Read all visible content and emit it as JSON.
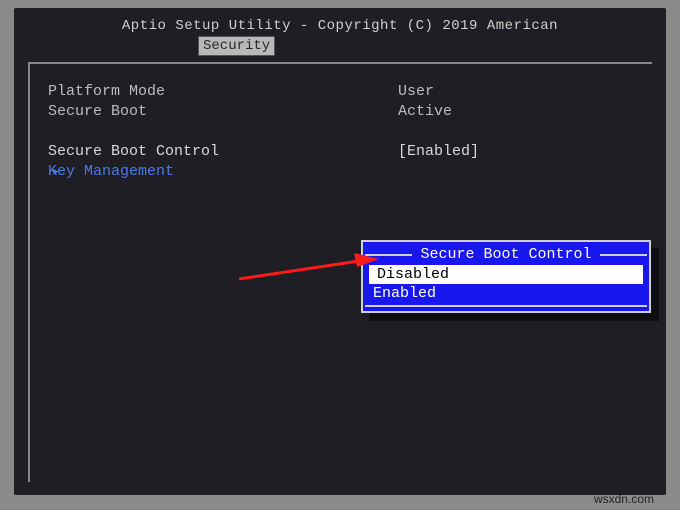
{
  "header": {
    "title": "Aptio Setup Utility - Copyright (C) 2019 American"
  },
  "tab": {
    "label": "Security"
  },
  "fields": {
    "platform_mode": {
      "label": "Platform Mode",
      "value": "User"
    },
    "secure_boot": {
      "label": "Secure Boot",
      "value": "Active"
    },
    "secure_boot_control": {
      "label": "Secure Boot Control",
      "value": "[Enabled]"
    },
    "key_management": {
      "label": "Key Management"
    }
  },
  "popup": {
    "title": "Secure Boot Control",
    "options": [
      "Disabled",
      "Enabled"
    ],
    "selected_index": 0
  },
  "watermark": "wsxdn.com"
}
